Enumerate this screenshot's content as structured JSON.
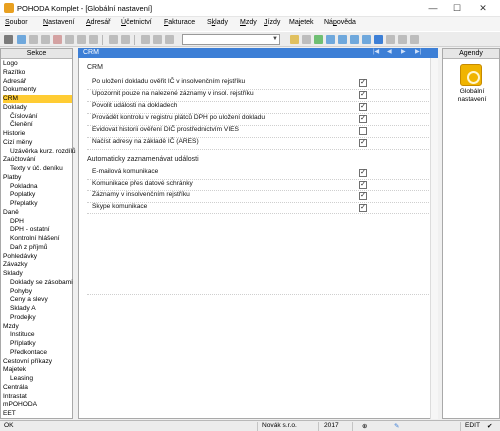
{
  "window": {
    "title": "POHODA Komplet - [Globální nastavení]",
    "minimize_glyph": "—",
    "maximize_glyph": "☐",
    "close_glyph": "✕"
  },
  "menu": [
    "Soubor",
    "Nastavení",
    "Adresář",
    "Účetnictví",
    "Fakturace",
    "Sklady",
    "Mzdy",
    "Jízdy",
    "Majetek",
    "Nápověda"
  ],
  "menu_underline": [
    "S",
    "N",
    "A",
    "Ú",
    "F",
    "k",
    "M",
    "J",
    "j",
    "p"
  ],
  "toolbar": {
    "combo_value": ""
  },
  "sidebar": {
    "header": "Sekce",
    "items": [
      "Logo",
      "Razítko",
      "Adresář",
      "Dokumenty",
      "CRM",
      "Doklady",
      "Číslování",
      "Členění",
      "Historie",
      "Cizí měny",
      "Uzávěrka kurz. rozdílů",
      "Zaúčtování",
      "Texty v úč. deníku",
      "Platby",
      "Pokladna",
      "Poplatky",
      "Přeplatky",
      "Daně",
      "DPH",
      "DPH - ostatní",
      "Kontrolní hlášení",
      "Daň z příjmů",
      "Pohledávky",
      "Závazky",
      "Sklady",
      "Doklady se zásobami",
      "Pohyby",
      "Ceny a slevy",
      "Sklady A",
      "Prodejky",
      "Mzdy",
      "Instituce",
      "Příplatky",
      "Předkontace",
      "Cestovní příkazy",
      "Majetek",
      "Leasing",
      "Centrála",
      "Intrastat",
      "mPOHODA",
      "EET"
    ],
    "selected": "CRM"
  },
  "content": {
    "header": "CRM",
    "section1_title": "CRM",
    "options": [
      {
        "label": "Po uložení dokladu ověřit IČ v insolvenčním rejstříku",
        "checked": true
      },
      {
        "label": "Upozornit pouze na nalezené záznamy v insol. rejstříku",
        "checked": true
      },
      {
        "label": "Povolit události na dokladech",
        "checked": true
      },
      {
        "label": "Provádět kontrolu v registru plátců DPH po uložení dokladu",
        "checked": true
      },
      {
        "label": "Evidovat historii ověření DIČ prostřednictvím VIES",
        "checked": false
      },
      {
        "label": "Načíst adresy na základě IČ (ARES)",
        "checked": true
      }
    ],
    "section2_title": "Automaticky zaznamenávat události",
    "events": [
      {
        "label": "E-mailová komunikace",
        "checked": true
      },
      {
        "label": "Komunikace přes datové schránky",
        "checked": true
      },
      {
        "label": "Záznamy v insolvenčním rejstříku",
        "checked": true
      },
      {
        "label": "Skype komunikace",
        "checked": true
      }
    ],
    "check_glyph": "✓"
  },
  "agendy": {
    "header": "Agendy",
    "item_label": "Globální nastavení"
  },
  "status": {
    "left": "OK",
    "company": "Novák s.r.o.",
    "year": "2017",
    "mode": "EDIT"
  },
  "colors": {
    "accent": "#3d7fd6",
    "selection": "#ffcc33"
  }
}
